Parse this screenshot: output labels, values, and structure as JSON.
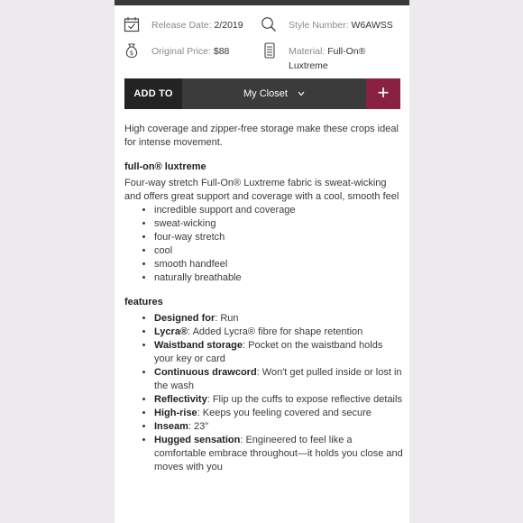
{
  "meta": {
    "release_label": "Release Date:",
    "release_value": "2/2019",
    "style_label": "Style Number:",
    "style_value": "W6AWSS",
    "price_label": "Original Price:",
    "price_value": "$88",
    "material_label": "Material:",
    "material_value_line1": "Full-On®",
    "material_value_line2": "Luxtreme"
  },
  "actions": {
    "add_to": "ADD TO",
    "closet": "My Closet",
    "closet_chevron": "⌵",
    "plus": "+"
  },
  "description": {
    "intro": "High coverage and zipper-free storage make these crops ideal for intense movement.",
    "fabric_title": "full-on® luxtreme",
    "fabric_para": "Four-way stretch Full-On® Luxtreme fabric is sweat-wicking and offers great support and coverage with a cool, smooth feel",
    "fabric_points": [
      "incredible support and coverage",
      "sweat-wicking",
      "four-way stretch",
      "cool",
      "smooth handfeel",
      "naturally breathable"
    ],
    "features_title": "features",
    "features": [
      {
        "name": "Designed for",
        "text": ": Run"
      },
      {
        "name": "Lycra®",
        "text": ": Added Lycra® fibre for shape retention"
      },
      {
        "name": "Waistband storage",
        "text": ": Pocket on the waistband holds your key or card"
      },
      {
        "name": "Continuous drawcord",
        "text": ": Won't get pulled inside or lost in the wash"
      },
      {
        "name": "Reflectivity",
        "text": ": Flip up the cuffs to expose reflective details"
      },
      {
        "name": "High-rise",
        "text": ": Keeps you feeling covered and secure"
      },
      {
        "name": "Inseam",
        "text": ": 23\""
      },
      {
        "name": "Hugged sensation",
        "text": ": Engineered to feel like a comfortable embrace throughout—it holds you close and moves with you"
      }
    ]
  }
}
